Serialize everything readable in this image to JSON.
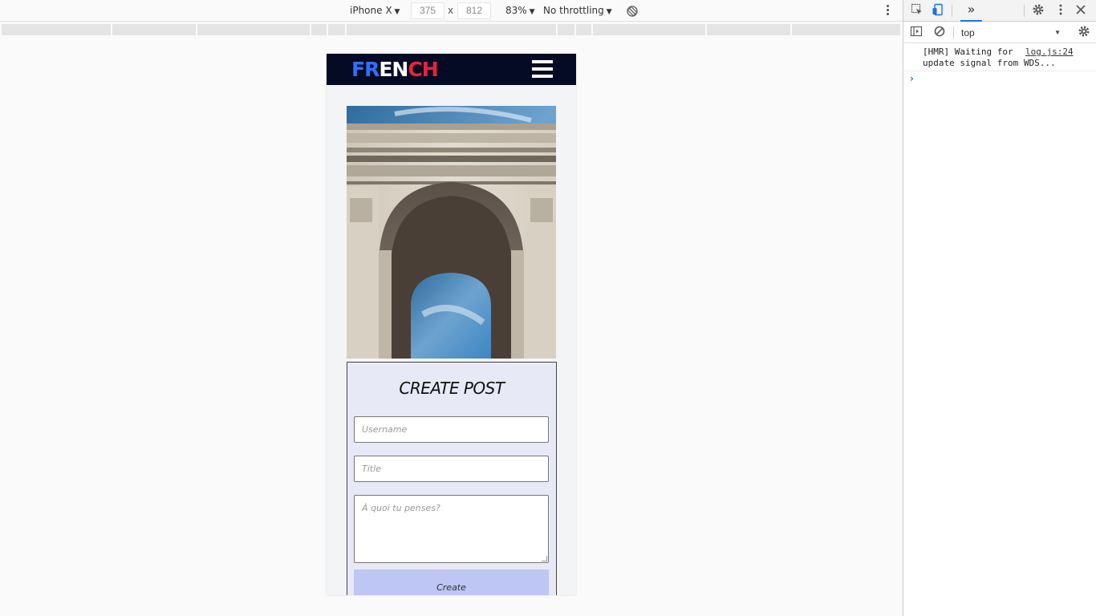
{
  "device_toolbar": {
    "device": "iPhone X",
    "width": "375",
    "height": "812",
    "times": "x",
    "zoom": "83%",
    "throttling": "No throttling"
  },
  "app": {
    "logo": {
      "part1": "FR",
      "part2": "EN",
      "part3": "CH"
    },
    "hero_image_alt": "Arc de Triomphe",
    "form": {
      "title": "CREATE POST",
      "username_placeholder": "Username",
      "title_placeholder": "Title",
      "body_placeholder": "À quoi tu penses?",
      "submit_label": "Create"
    }
  },
  "devtools": {
    "context": "top",
    "log_message_line1": "[HMR] Waiting for",
    "log_message_line2": "update signal from WDS...",
    "log_source": "log.js:24",
    "prompt": "›"
  },
  "colors": {
    "nav_bg": "#050b24",
    "logo_blue": "#2f6fff",
    "logo_red": "#e8233a",
    "form_bg": "#e8e9f7",
    "button_bg": "#bec6f4",
    "devtools_accent": "#1a73e8"
  }
}
